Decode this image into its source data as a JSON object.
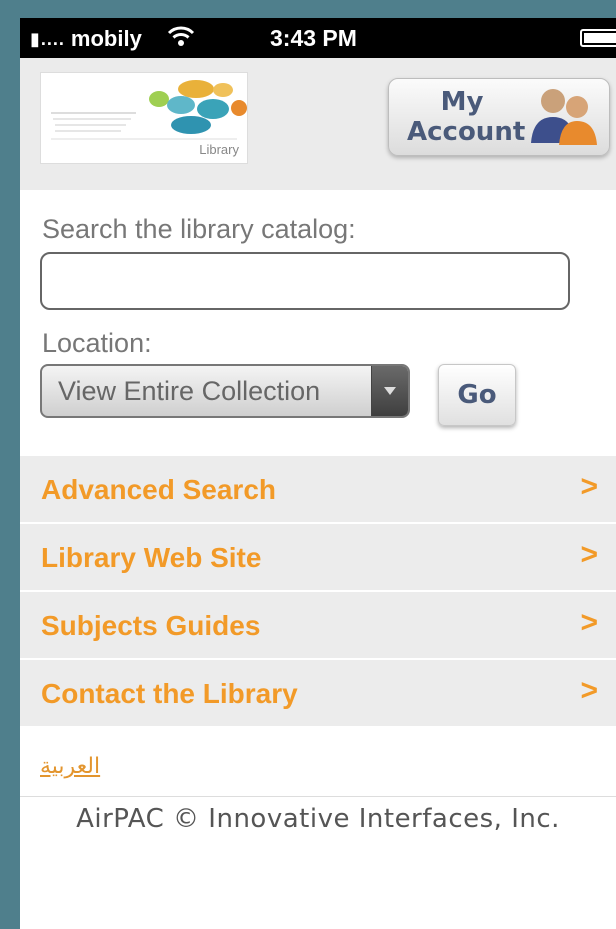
{
  "status_bar": {
    "carrier": "mobily",
    "time": "3:43 PM"
  },
  "header": {
    "logo_caption": "Library",
    "my_account_line1": "My",
    "my_account_line2": "Account"
  },
  "search": {
    "label": "Search the library catalog:",
    "value": "",
    "placeholder": ""
  },
  "location": {
    "label": "Location:",
    "selected": "View Entire Collection",
    "go_label": "Go"
  },
  "nav": {
    "items": [
      {
        "label": "Advanced Search"
      },
      {
        "label": "Library Web Site"
      },
      {
        "label": "Subjects Guides"
      },
      {
        "label": "Contact the Library"
      }
    ]
  },
  "language_link": "العربية",
  "footer": "AirPAC © Innovative Interfaces, Inc.",
  "colors": {
    "accent_orange": "#f29a28",
    "button_text": "#4a5a7a",
    "list_bg": "#ececec"
  }
}
